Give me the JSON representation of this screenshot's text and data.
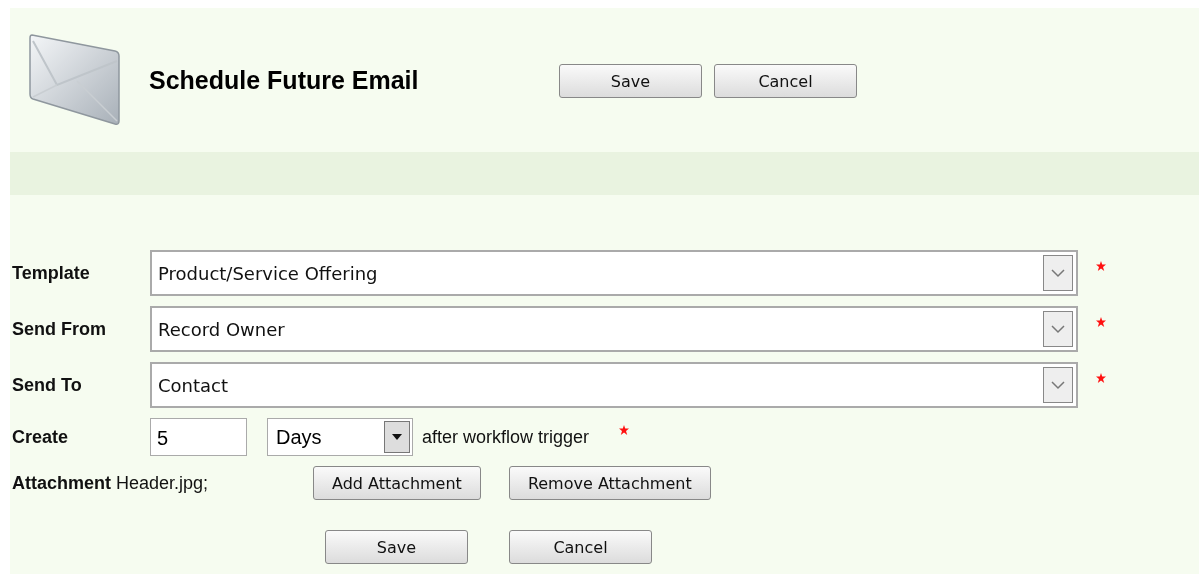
{
  "header": {
    "title": "Schedule Future Email",
    "buttons": [
      "Save",
      "Cancel"
    ]
  },
  "fields": [
    {
      "kind": "select",
      "label": "Template",
      "value": "Product/Service Offering",
      "required": true
    },
    {
      "kind": "select",
      "label": "Send From",
      "value": "Record Owner",
      "required": true
    },
    {
      "kind": "select",
      "label": "Send To",
      "value": "Contact",
      "required": true
    },
    {
      "kind": "delay",
      "label": "Create",
      "value": "5",
      "unit": "Days",
      "suffix": "after workflow trigger",
      "required": true
    },
    {
      "kind": "attachment",
      "label": "Attachment",
      "value": "Header.jpg;",
      "buttons": [
        "Add Attachment",
        "Remove Attachment"
      ]
    }
  ],
  "footer_buttons": [
    "Save",
    "Cancel"
  ]
}
